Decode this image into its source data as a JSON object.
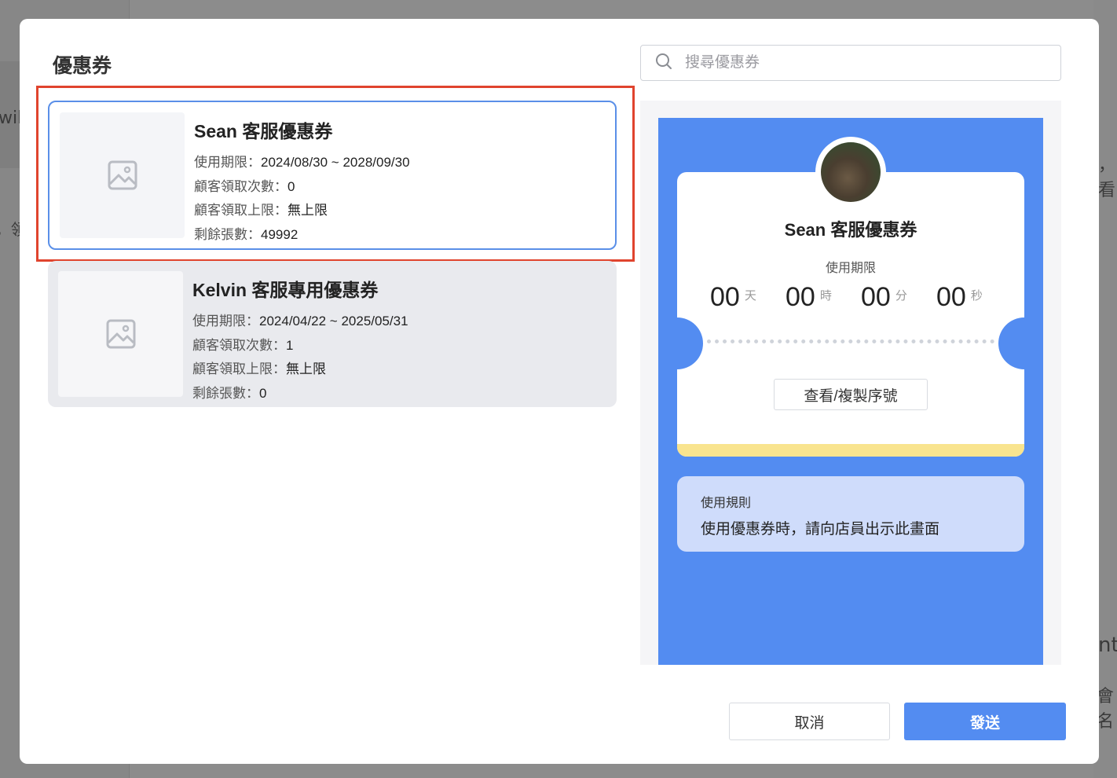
{
  "background": {
    "fragments": [
      "will",
      "，領",
      "，看",
      "nt",
      "會名"
    ]
  },
  "modal": {
    "title": "優惠券",
    "search": {
      "placeholder": "搜尋優惠券"
    },
    "coupons": [
      {
        "name": "Sean 客服優惠券",
        "period_label": "使用期限：",
        "period": "2024/08/30 ~ 2028/09/30",
        "claimed_label": "顧客領取次數：",
        "claimed": "0",
        "limit_label": "顧客領取上限：",
        "limit": "無上限",
        "remaining_label": "剩餘張數：",
        "remaining": "49992",
        "selected": true
      },
      {
        "name": "Kelvin 客服專用優惠券",
        "period_label": "使用期限：",
        "period": "2024/04/22 ~ 2025/05/31",
        "claimed_label": "顧客領取次數：",
        "claimed": "1",
        "limit_label": "顧客領取上限：",
        "limit": "無上限",
        "remaining_label": "剩餘張數：",
        "remaining": "0",
        "selected": false
      }
    ],
    "preview": {
      "title": "Sean 客服優惠券",
      "period_label": "使用期限",
      "countdown": [
        {
          "value": "00",
          "unit": "天"
        },
        {
          "value": "00",
          "unit": "時"
        },
        {
          "value": "00",
          "unit": "分"
        },
        {
          "value": "00",
          "unit": "秒"
        }
      ],
      "serial_button": "查看/複製序號",
      "rules_title": "使用規則",
      "rules_text": "使用優惠券時，請向店員出示此畫面"
    },
    "footer": {
      "cancel": "取消",
      "send": "發送"
    }
  },
  "colors": {
    "accent": "#538cf1",
    "highlight": "#e0442e",
    "ticket_stripe": "#f9e48f"
  }
}
